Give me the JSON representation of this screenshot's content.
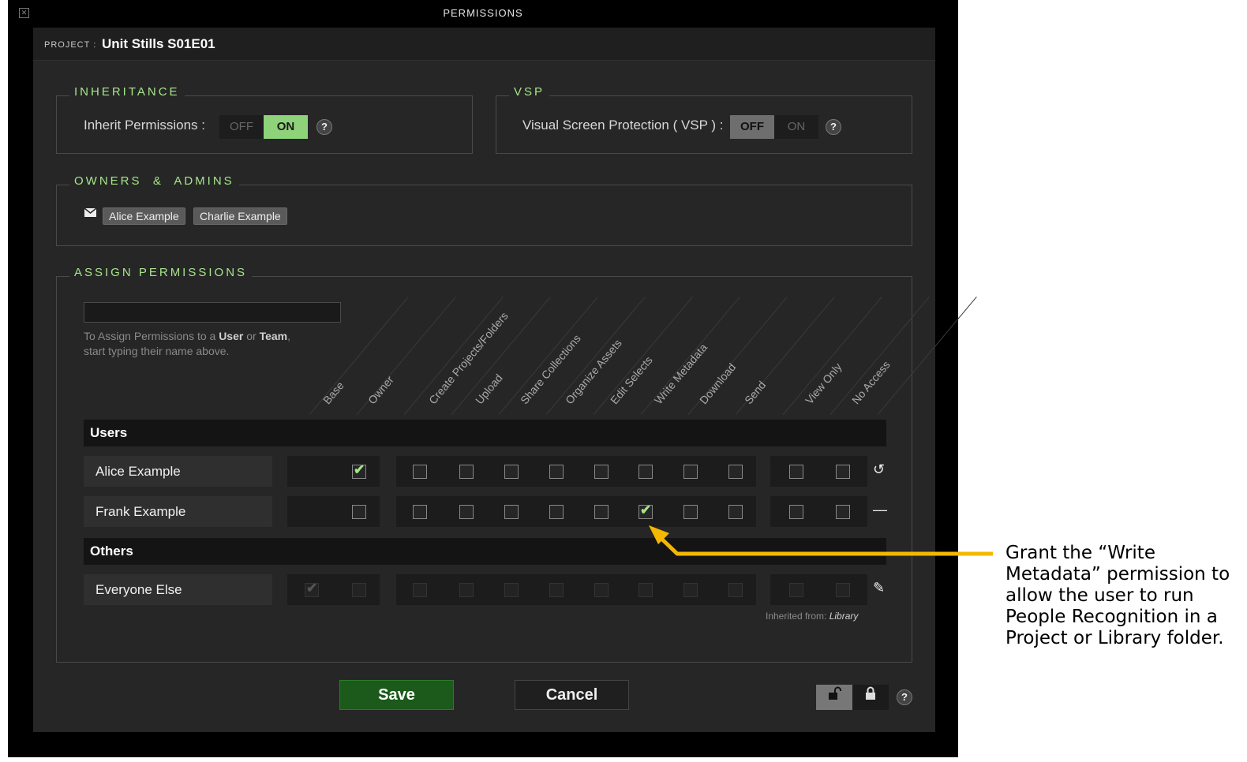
{
  "window": {
    "title": "PERMISSIONS"
  },
  "project": {
    "label": "PROJECT :",
    "name": "Unit Stills S01E01"
  },
  "inheritance": {
    "legend": "INHERITANCE",
    "label": "Inherit Permissions :",
    "off": "OFF",
    "on": "ON",
    "value": "ON",
    "help": "?"
  },
  "vsp": {
    "legend": "VSP",
    "label": "Visual Screen Protection ( VSP ) :",
    "off": "OFF",
    "on": "ON",
    "value": "OFF",
    "help": "?"
  },
  "owners": {
    "legend": "OWNERS  &  ADMINS",
    "chips": [
      "Alice Example",
      "Charlie Example"
    ]
  },
  "assign": {
    "legend": "ASSIGN PERMISSIONS",
    "search_value": "",
    "hint_pre": "To Assign Permissions to a ",
    "hint_user": "User",
    "hint_or": " or ",
    "hint_team": "Team",
    "hint_post": ",",
    "hint_line2": "start typing their name above.",
    "columns": [
      "Base",
      "Owner",
      "Create Projects/Folders",
      "Upload",
      "Share Collections",
      "Organize Assets",
      "Edit Selects",
      "Write Metadata",
      "Download",
      "Send",
      "View Only",
      "No Access"
    ]
  },
  "sections": {
    "users": "Users",
    "others": "Others"
  },
  "rows": [
    {
      "name": "Alice Example",
      "checked": [
        "Owner"
      ],
      "action_icon": "undo-icon"
    },
    {
      "name": "Frank Example",
      "checked": [
        "Write Metadata"
      ],
      "action_icon": "minus-icon"
    },
    {
      "name": "Everyone Else",
      "checked": [
        "Base"
      ],
      "dimmed": true,
      "action_icon": "pencil-icon"
    }
  ],
  "inherited": {
    "prefix": "Inherited from: ",
    "source": "Library"
  },
  "buttons": {
    "save": "Save",
    "cancel": "Cancel"
  },
  "lock": {
    "unlock_icon": "unlock-icon",
    "lock_icon": "lock-icon",
    "help": "?"
  },
  "callout": {
    "text": "Grant the “Write Metadata” permission to allow the user to run People Recognition in a Project or Library folder.",
    "arrow_color": "#f5b800"
  },
  "colors": {
    "accent": "#a6e58a",
    "save": "#1b5a1b",
    "arrow": "#f5b800"
  }
}
